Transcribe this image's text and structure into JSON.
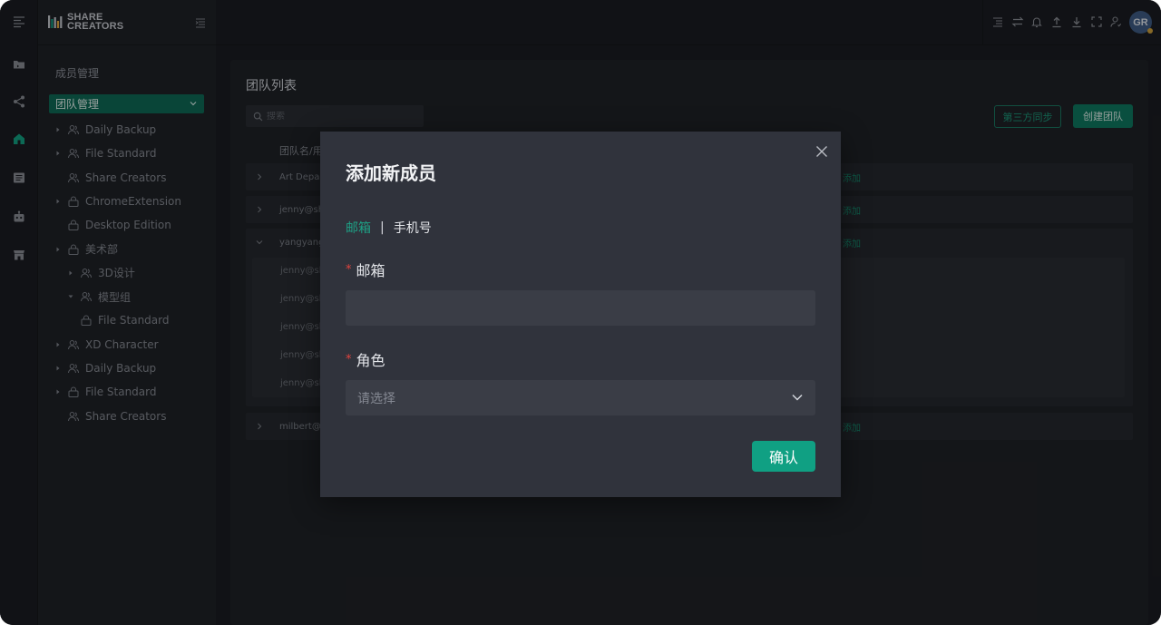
{
  "app": {
    "logo_line1": "SHARE",
    "logo_line2": "CREATORS",
    "accent": "#10a083"
  },
  "rail": {
    "icons": [
      "folder-icon",
      "share-icon",
      "home-icon",
      "list-icon",
      "robot-icon",
      "store-icon"
    ],
    "active": "home-icon"
  },
  "sidebar": {
    "section_title": "成员管理",
    "team_select": "团队管理",
    "tree": [
      {
        "label": "Daily Backup",
        "icon": "users-icon",
        "arrow": "right",
        "level": 0
      },
      {
        "label": "File Standard",
        "icon": "users-icon",
        "arrow": "right",
        "level": 0
      },
      {
        "label": "Share Creators",
        "icon": "users-icon",
        "arrow": "none",
        "level": 0
      },
      {
        "label": "ChromeExtension",
        "icon": "lock-icon",
        "arrow": "right",
        "level": 0
      },
      {
        "label": "Desktop Edition",
        "icon": "lock-icon",
        "arrow": "none",
        "level": 0
      },
      {
        "label": "美术部",
        "icon": "lock-icon",
        "arrow": "right",
        "level": 0
      },
      {
        "label": "3D设计",
        "icon": "users-icon",
        "arrow": "right",
        "level": 1
      },
      {
        "label": "模型组",
        "icon": "users-icon",
        "arrow": "down",
        "level": 1
      },
      {
        "label": "File Standard",
        "icon": "lock-icon",
        "arrow": "none",
        "level": 1
      },
      {
        "label": "XD Character",
        "icon": "users-icon",
        "arrow": "right",
        "level": 0
      },
      {
        "label": "Daily Backup",
        "icon": "users-icon",
        "arrow": "right",
        "level": 0
      },
      {
        "label": "File Standard",
        "icon": "lock-icon",
        "arrow": "right",
        "level": 0
      },
      {
        "label": "Share Creators",
        "icon": "users-icon",
        "arrow": "none",
        "level": 0
      }
    ]
  },
  "topbar": {
    "icons": [
      "align-icon",
      "swap-icon",
      "bell-icon",
      "upload-icon",
      "download-icon",
      "fullscreen-icon",
      "user-icon"
    ],
    "avatar_initials": "GR"
  },
  "main": {
    "title": "团队列表",
    "search_placeholder": "搜索",
    "sync_button": "第三方同步",
    "create_button": "创建团队",
    "column_header": "团队名/用",
    "rows": [
      {
        "text": "Art Depar",
        "link": "添加"
      },
      {
        "text": "jenny@sha",
        "link": "添加"
      },
      {
        "text": "yangyang",
        "link": "添加"
      },
      {
        "text": "milbert@s",
        "link": "添加"
      }
    ],
    "sub_rows": [
      "jenny@sha",
      "jenny@sha",
      "jenny@sha",
      "jenny@sha",
      "jenny@sha"
    ]
  },
  "modal": {
    "title": "添加新成员",
    "tab_email": "邮箱",
    "tab_separator": "|",
    "tab_phone": "手机号",
    "email_label": "邮箱",
    "email_value": "",
    "role_label": "角色",
    "role_placeholder": "请选择",
    "confirm": "确认"
  }
}
